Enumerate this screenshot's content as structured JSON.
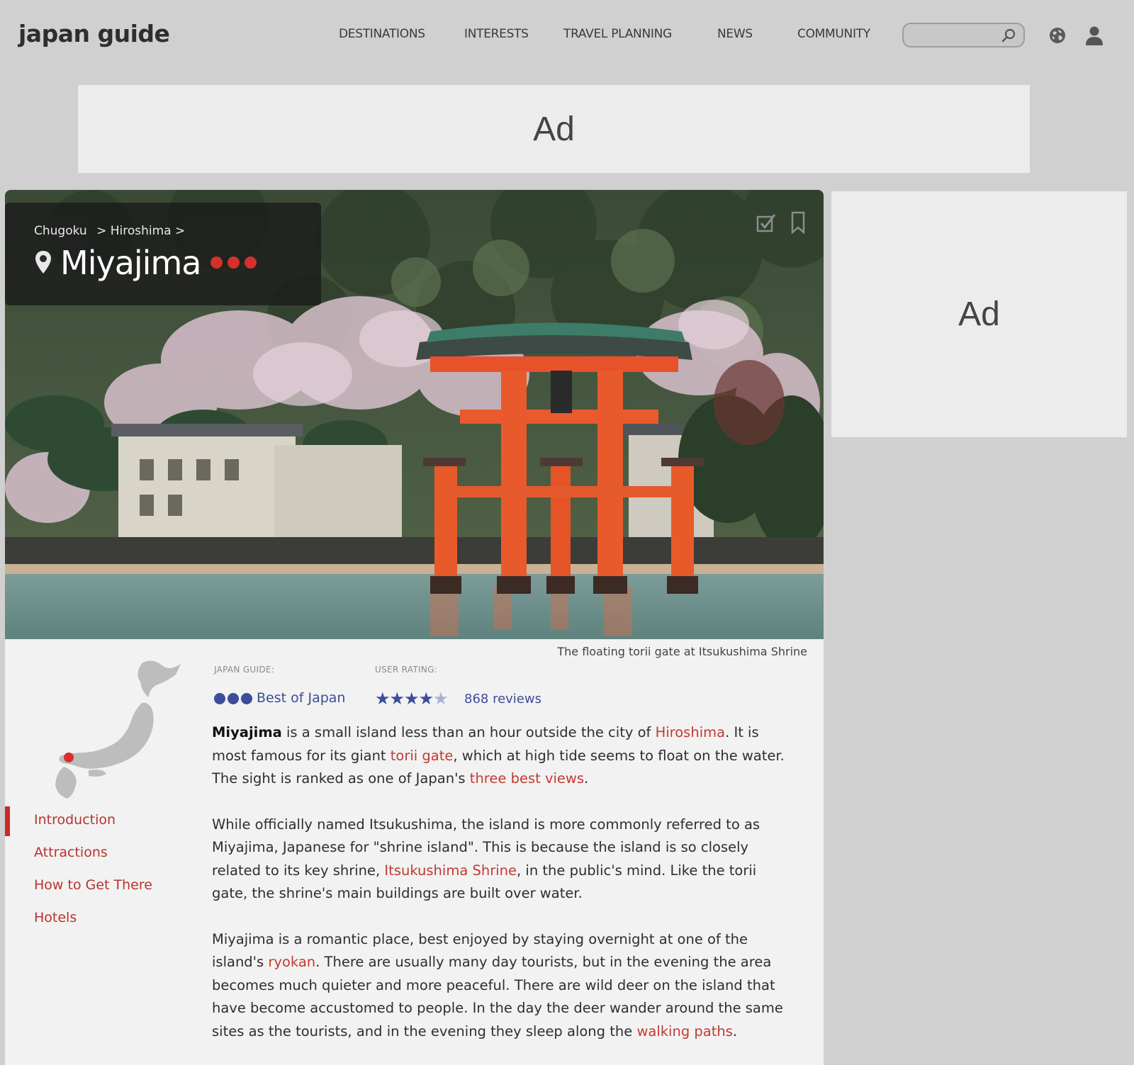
{
  "header": {
    "logo": "japan guide",
    "nav": [
      "DESTINATIONS",
      "INTERESTS",
      "TRAVEL PLANNING",
      "NEWS",
      "COMMUNITY"
    ],
    "search_placeholder": ""
  },
  "ads": {
    "top": "Ad",
    "side": "Ad"
  },
  "hero": {
    "breadcrumb": [
      "Chugoku",
      "> Hiroshima >"
    ],
    "title": "Miyajima",
    "caption": "The floating torii gate at Itsukushima Shrine"
  },
  "ratings": {
    "guide_label": "JAPAN GUIDE:",
    "guide_value": "Best of Japan",
    "user_label": "USER RATING:",
    "stars_filled": 4,
    "stars_total": 5,
    "reviews": "868 reviews"
  },
  "sidebar": {
    "items": [
      "Introduction",
      "Attractions",
      "How to Get There",
      "Hotels"
    ],
    "active": "Introduction"
  },
  "article": {
    "p1": {
      "s1": "Miyajima",
      "s2": " is a small island less than an hour outside the city of ",
      "l1": "Hiroshima",
      "s3": ". It is most famous for its giant ",
      "l2": "torii gate",
      "s4": ", which at high tide seems to float on the water. The sight is ranked as one of Japan's ",
      "l3": "three best views",
      "s5": "."
    },
    "p2": {
      "s1": "While officially named Itsukushima, the island is more commonly referred to as Miyajima, Japanese for \"shrine island\". This is because the island is so closely related to its key shrine, ",
      "l1": "Itsukushima Shrine",
      "s2": ", in the public's mind. Like the torii gate, the shrine's main buildings are built over water."
    },
    "p3": {
      "s1": "Miyajima is a romantic place, best enjoyed by staying overnight at one of the island's ",
      "l1": "ryokan",
      "s2": ". There are usually many day tourists, but in the evening the area becomes much quieter and more peaceful. There are wild deer on the island that have become accustomed to people. In the day the deer wander around the same sites as the tourists, and in the evening they sleep along the ",
      "l2": "walking paths",
      "s3": "."
    }
  },
  "colors": {
    "link": "#c23a32",
    "accent_red": "#d6302b",
    "rating_blue": "#3c4d9b",
    "page_bg": "#d0d0d0",
    "card_bg": "#f2f2f2"
  },
  "icons": [
    "search-icon",
    "globe-icon",
    "user-icon",
    "location-pin-icon",
    "check-icon",
    "bookmark-icon"
  ]
}
